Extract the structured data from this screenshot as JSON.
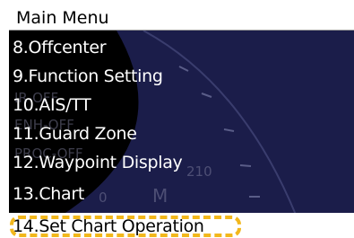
{
  "menu": {
    "title": "Main Menu",
    "items": [
      {
        "label": "8.Offcenter"
      },
      {
        "label": "9.Function Setting"
      },
      {
        "label": "10.AIS/TT"
      },
      {
        "label": "11.Guard Zone"
      },
      {
        "label": "12.Waypoint Display"
      },
      {
        "label": "13.Chart"
      },
      {
        "label": "14.Set Chart Operation",
        "selected": true
      }
    ]
  },
  "background": {
    "ghost_texts": [
      "IR-OFF",
      "ENH-OFF",
      "PROC-OFF",
      "210",
      "0",
      "M"
    ]
  },
  "colors": {
    "menu_bg": "#000000",
    "menu_text": "#ffffff",
    "selected_bg": "#ffffff",
    "selected_text": "#000000",
    "radar_bg": "#1b1d4a",
    "highlight": "#f2b71c"
  }
}
